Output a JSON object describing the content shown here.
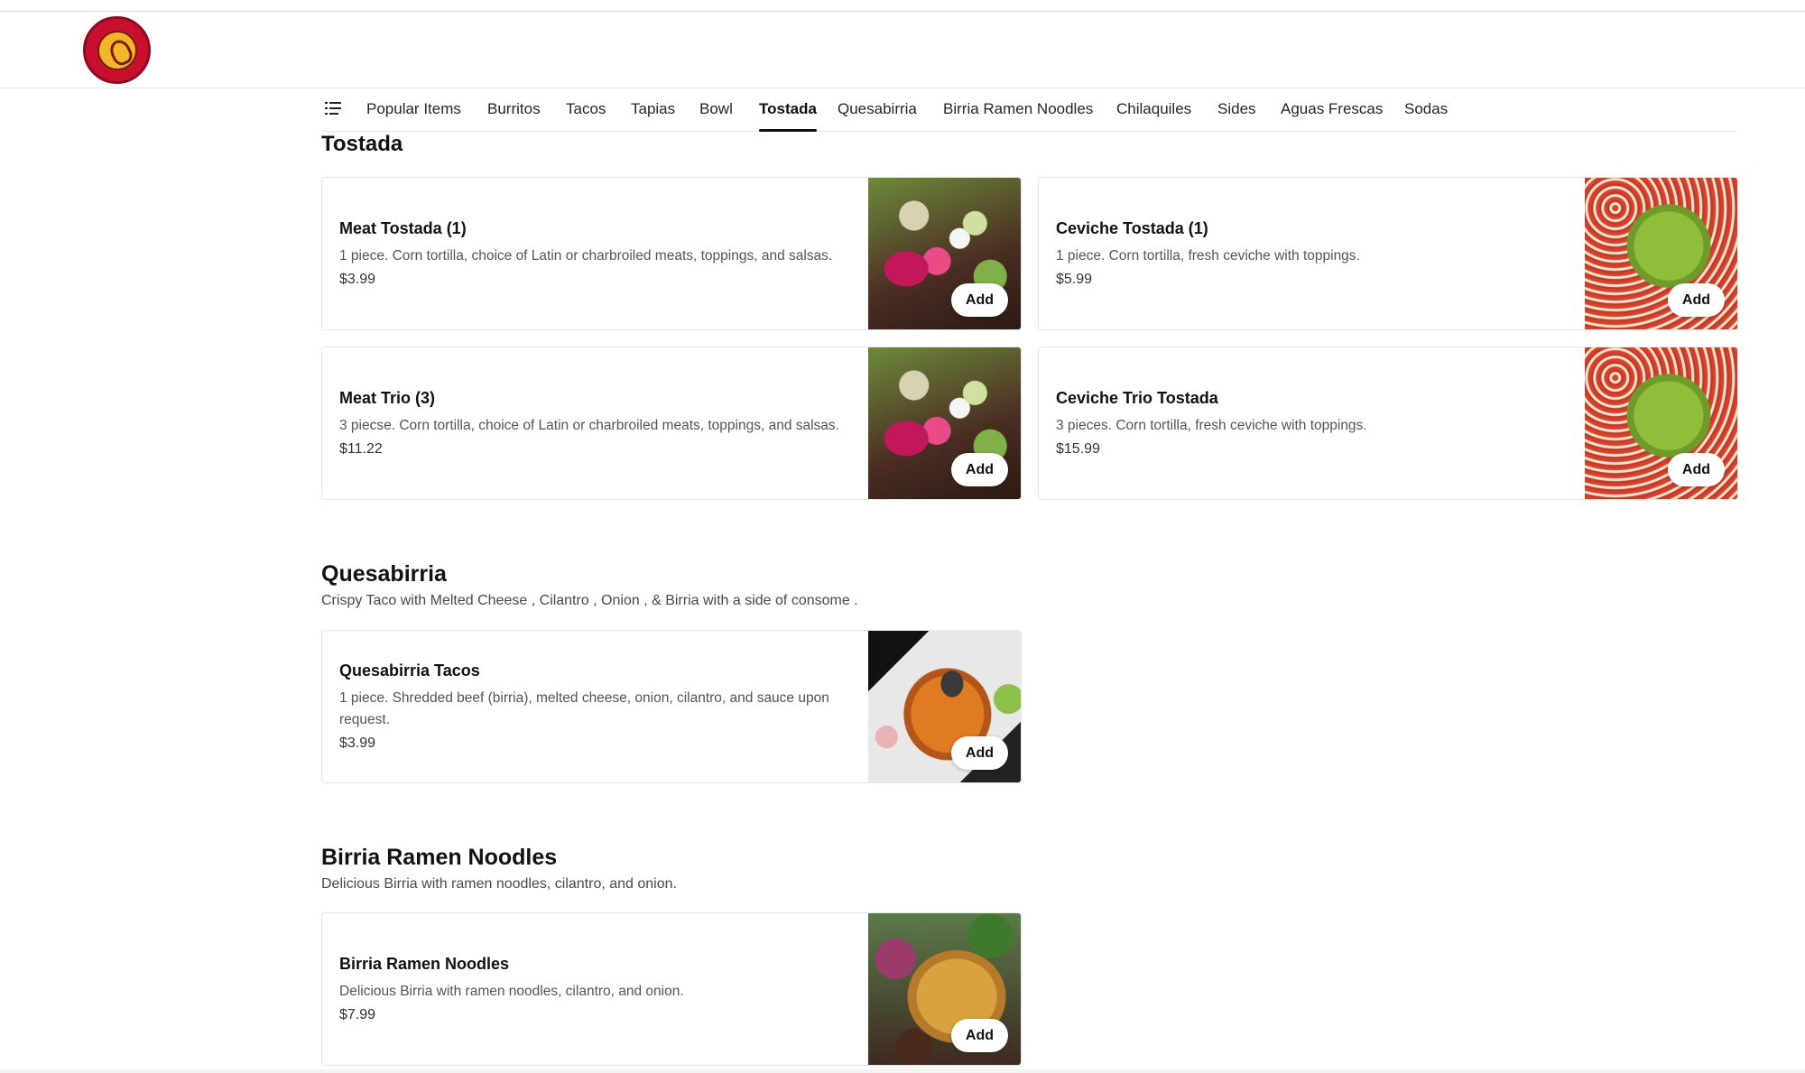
{
  "header": {
    "logo_alt": "El Burro Tacos & Beer",
    "logo_icon": "donkey-logo"
  },
  "nav": {
    "menu_icon": "list-icon",
    "tabs": [
      {
        "label": "Popular Items"
      },
      {
        "label": "Burritos"
      },
      {
        "label": "Tacos"
      },
      {
        "label": "Tapias"
      },
      {
        "label": "Bowl"
      },
      {
        "label": "Tostada",
        "active": true
      },
      {
        "label": "Quesabirria"
      },
      {
        "label": "Birria Ramen Noodles"
      },
      {
        "label": "Chilaquiles"
      },
      {
        "label": "Sides"
      },
      {
        "label": "Aguas Frescas"
      },
      {
        "label": "Sodas"
      }
    ]
  },
  "sections": [
    {
      "title": "Tostada",
      "items": [
        {
          "name": "Meat Tostada (1)",
          "desc": "1 piece. Corn tortilla, choice of Latin or charbroiled meats, toppings, and salsas.",
          "price": "$3.99",
          "add": "Add"
        },
        {
          "name": "Ceviche Tostada (1)",
          "desc": "1 piece. Corn tortilla, fresh ceviche with toppings.",
          "price": "$5.99",
          "add": "Add"
        },
        {
          "name": "Meat Trio (3)",
          "desc": "3 piecse. Corn tortilla, choice of Latin or charbroiled meats, toppings, and salsas.",
          "price": "$11.22",
          "add": "Add"
        },
        {
          "name": "Ceviche Trio Tostada",
          "desc": "3 pieces. Corn tortilla, fresh ceviche with toppings.",
          "price": "$15.99",
          "add": "Add"
        }
      ]
    },
    {
      "title": "Quesabirria",
      "subtitle": "Crispy Taco with Melted Cheese , Cilantro , Onion , & Birria with a side of consome .",
      "items": [
        {
          "name": "Quesabirria Tacos",
          "desc": "1 piece. Shredded beef (birria), melted cheese, onion, cilantro, and sauce upon request.",
          "price": "$3.99",
          "add": "Add"
        }
      ]
    },
    {
      "title": "Birria Ramen Noodles",
      "subtitle": "Delicious Birria with ramen noodles, cilantro, and onion.",
      "items": [
        {
          "name": "Birria Ramen Noodles",
          "desc": "Delicious Birria with ramen noodles, cilantro, and onion.",
          "price": "$7.99",
          "add": "Add"
        }
      ]
    }
  ]
}
